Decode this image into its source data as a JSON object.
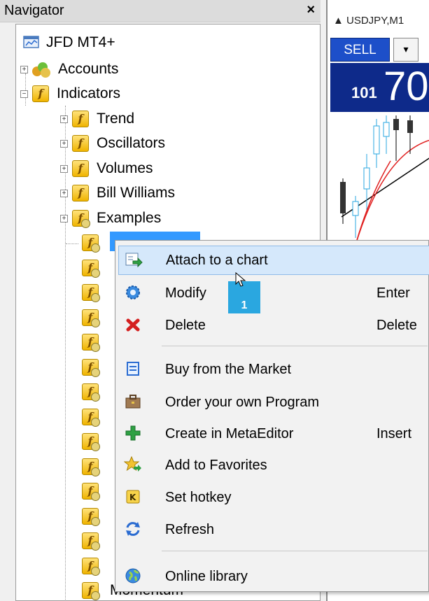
{
  "navigator": {
    "title": "Navigator",
    "close": "×",
    "root": "JFD MT4+",
    "accounts": "Accounts",
    "indicators": "Indicators",
    "groups": [
      "Trend",
      "Oscillators",
      "Volumes",
      "Bill Williams",
      "Examples"
    ],
    "bottom_item": "Momentum"
  },
  "chart": {
    "tab": "USDJPY,M1",
    "sell": "SELL",
    "arrow": "▾",
    "price_small": "101",
    "price_big": "70"
  },
  "context_menu": {
    "items": [
      {
        "label": "Attach to a chart",
        "shortcut": "",
        "icon": "attach-chart-icon"
      },
      {
        "label": "Modify",
        "shortcut": "Enter",
        "icon": "gear-icon"
      },
      {
        "label": "Delete",
        "shortcut": "Delete",
        "icon": "red-x-icon"
      },
      {
        "label": "Buy from the Market",
        "shortcut": "",
        "icon": "market-icon"
      },
      {
        "label": "Order your own Program",
        "shortcut": "",
        "icon": "briefcase-icon"
      },
      {
        "label": "Create in MetaEditor",
        "shortcut": "Insert",
        "icon": "green-plus-icon"
      },
      {
        "label": "Add to Favorites",
        "shortcut": "",
        "icon": "star-icon"
      },
      {
        "label": "Set hotkey",
        "shortcut": "",
        "icon": "hotkey-icon"
      },
      {
        "label": "Refresh",
        "shortcut": "",
        "icon": "refresh-icon"
      },
      {
        "label": "Online library",
        "shortcut": "",
        "icon": "globe-icon"
      }
    ]
  },
  "annotation": {
    "badge": "1"
  },
  "colors": {
    "selection": "#3399ff",
    "menu_highlight": "#d5e8fb",
    "sell": "#1d4fc9",
    "price_bg": "#0e2a8a",
    "badge": "#2aa7e0"
  }
}
